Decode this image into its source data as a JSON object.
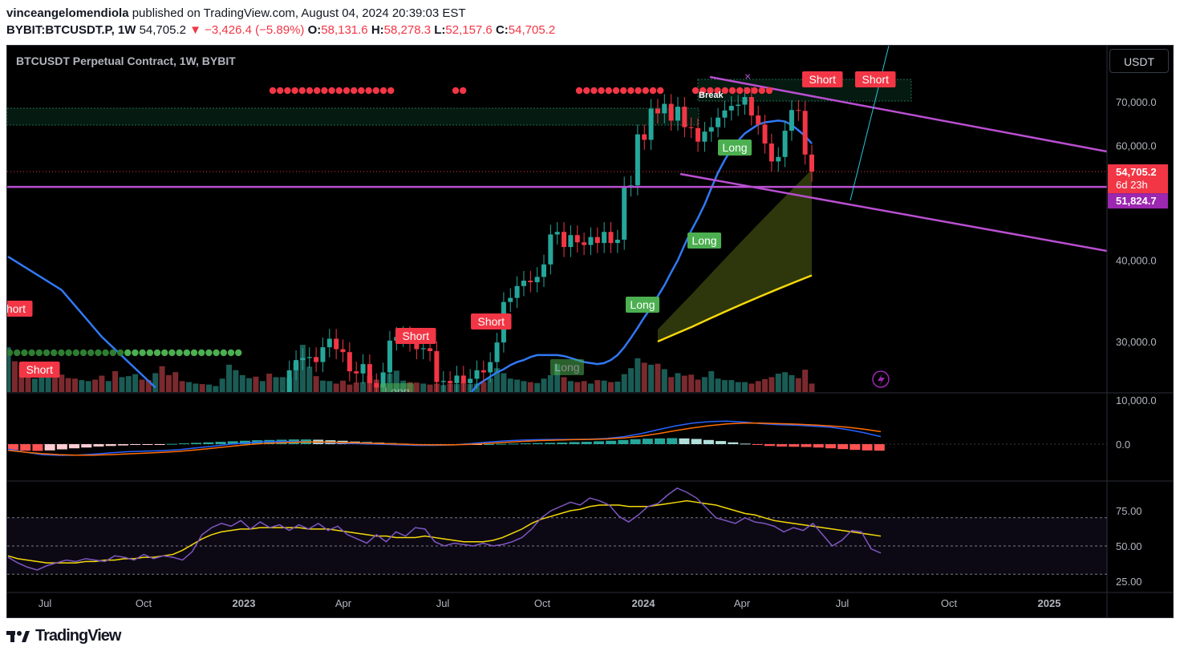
{
  "publisher": {
    "user": "vinceangelomendiola",
    "text": "published on TradingView.com, August 04, 2024 20:39:03 EST"
  },
  "symbol_line": {
    "symbol": "BYBIT:BTCUSDT.P, 1W",
    "last": "54,705.2",
    "change": "▼ −3,426.4 (−5.89%)",
    "o_label": "O:",
    "o": "58,131.6",
    "h_label": "H:",
    "h": "58,278.3",
    "l_label": "L:",
    "l": "52,157.6",
    "c_label": "C:",
    "c": "54,705.2"
  },
  "chart_title": "BTCUSDT Perpetual Contract, 1W, BYBIT",
  "currency_button": "USDT",
  "footer_logo": "TradingView",
  "colors": {
    "up": "#26a69a",
    "down": "#f23645",
    "channel": "#b94fd1",
    "ema": "#3179f5",
    "sma": "#f5d90a",
    "label_long": "#4caf50",
    "label_short": "#f23645"
  },
  "chart_data": [
    {
      "type": "line",
      "title": "BTCUSDT Perpetual Contract, 1W, BYBIT",
      "price_ticks": [
        "70,000.0",
        "60,000.0",
        "40,000.0",
        "30,000.0"
      ],
      "price_tick_values": [
        70000,
        60000,
        40000,
        30000
      ],
      "x_ticks": [
        "Jul",
        "Oct",
        "2023",
        "Apr",
        "Jul",
        "Oct",
        "2024",
        "Apr",
        "Jul",
        "Oct",
        "2025"
      ],
      "last_price_label": "54,705.2",
      "countdown_label": "6d 23h",
      "level_label": "51,824.7",
      "level_value": 51824.7,
      "signal_labels": [
        {
          "text": "Short",
          "kind": "short",
          "week": 4
        },
        {
          "text": "Short",
          "kind": "short",
          "week": 5
        },
        {
          "text": "Short",
          "kind": "short",
          "week": 51
        },
        {
          "text": "Long",
          "kind": "long",
          "week": 51
        },
        {
          "text": "Short",
          "kind": "short",
          "week": 60
        },
        {
          "text": "Long",
          "kind": "long",
          "week": 72
        },
        {
          "text": "Long",
          "kind": "long",
          "week": 83
        },
        {
          "text": "Long",
          "kind": "long",
          "week": 90
        },
        {
          "text": "Long",
          "kind": "long",
          "week": 95
        },
        {
          "text": "Short",
          "kind": "short",
          "week": 105
        },
        {
          "text": "Short",
          "kind": "short",
          "week": 110
        }
      ],
      "annotation": "Break",
      "closes": [
        22000,
        21500,
        20800,
        20500,
        21200,
        21900,
        23600,
        23300,
        21300,
        20000,
        19900,
        20200,
        21500,
        19300,
        18800,
        19500,
        19100,
        19400,
        20600,
        20900,
        19600,
        19100,
        21200,
        20800,
        17200,
        16600,
        16200,
        16800,
        17000,
        16400,
        16500,
        16600,
        17000,
        20900,
        22900,
        23100,
        23500,
        22600,
        24200,
        21600,
        23100,
        24300,
        27100,
        28100,
        28300,
        28400,
        27900,
        29400,
        30300,
        29200,
        28900,
        27000,
        26800,
        27700,
        25900,
        25500,
        26900,
        30100,
        30500,
        30600,
        30000,
        29200,
        29300,
        29000,
        26000,
        26100,
        25900,
        26600,
        25900,
        26300,
        27100,
        26900,
        27900,
        29900,
        34500,
        35000,
        36500,
        37200,
        37000,
        37700,
        39400,
        43800,
        44200,
        41900,
        43700,
        42600,
        42200,
        43400,
        42500,
        44200,
        42500,
        43000,
        51900,
        52100,
        62400,
        61200,
        68300,
        67200,
        69500,
        65500,
        68800,
        64000,
        63800,
        60800,
        63000,
        64000,
        66200,
        67900,
        69000,
        69300,
        71200,
        66700,
        64600,
        60400,
        56700,
        57600,
        63200,
        68000,
        67800,
        58100,
        54700
      ],
      "ema20": [
        22800,
        22200,
        21300,
        20600,
        19600,
        18800,
        18200,
        17500,
        16800,
        16300,
        16100,
        16200,
        16600,
        17300,
        18300,
        19300,
        20400,
        21500,
        22500,
        23300,
        24000,
        24900,
        25700,
        26100,
        26500,
        26900,
        27200,
        27600,
        27900,
        28100,
        28400,
        28600,
        28600,
        28600,
        28600,
        28500,
        28300,
        28100,
        27900,
        27800,
        27700,
        27800,
        28100,
        28600,
        29400,
        30400,
        31500,
        32700,
        33800,
        35200,
        36600,
        38300,
        40000,
        42200,
        44400,
        46400,
        48700,
        51600,
        54500,
        57000,
        59200,
        61000,
        62600,
        63600,
        64600,
        65100,
        65300,
        65500,
        65300,
        64500,
        63300,
        62000,
        60400
      ],
      "sma200": [
        30000,
        30800,
        31600,
        32500,
        33400,
        34300,
        35200,
        36100,
        37000,
        37900
      ],
      "volume": [
        0.9,
        0.62,
        0.55,
        0.35,
        0.27,
        0.32,
        0.4,
        0.3,
        0.35,
        0.28,
        0.27,
        0.24,
        0.22,
        0.25,
        0.33,
        0.22,
        0.42,
        0.3,
        0.32,
        0.36,
        0.25,
        0.24,
        0.38,
        0.52,
        0.34,
        0.4,
        0.22,
        0.2,
        0.17,
        0.16,
        0.15,
        0.12,
        0.27,
        0.55,
        0.44,
        0.34,
        0.28,
        0.31,
        0.22,
        0.37,
        0.3,
        0.3,
        0.28,
        0.6,
        0.95,
        0.51,
        0.32,
        0.23,
        0.22,
        0.17,
        0.23,
        0.15,
        0.19,
        0.2,
        0.32,
        0.25,
        0.16,
        0.37,
        0.43,
        0.23,
        0.2,
        0.19,
        0.17,
        0.15,
        0.17,
        0.14,
        0.17,
        0.16,
        0.2,
        0.16,
        0.17,
        0.2,
        0.28,
        0.48,
        0.38,
        0.27,
        0.25,
        0.22,
        0.2,
        0.18,
        0.27,
        0.34,
        0.56,
        0.3,
        0.22,
        0.2,
        0.22,
        0.17,
        0.24,
        0.23,
        0.2,
        0.21,
        0.36,
        0.48,
        0.68,
        0.59,
        0.55,
        0.57,
        0.46,
        0.3,
        0.38,
        0.33,
        0.35,
        0.25,
        0.3,
        0.42,
        0.27,
        0.24,
        0.24,
        0.2,
        0.2,
        0.17,
        0.22,
        0.26,
        0.3,
        0.37,
        0.4,
        0.34,
        0.28,
        0.45,
        0.17
      ]
    },
    {
      "type": "bar",
      "title": "",
      "y_ticks": [
        "10,000.0",
        "0.0"
      ],
      "y_tick_values": [
        10000,
        0
      ],
      "histogram": [
        -2200,
        -2500,
        -2600,
        -2400,
        -2000,
        -1600,
        -1300,
        -900,
        -700,
        -500,
        -300,
        -200,
        -100,
        100,
        300,
        500,
        700,
        900,
        1100,
        1300,
        1500,
        1600,
        1700,
        1800,
        1800,
        1700,
        1500,
        1300,
        1000,
        800,
        600,
        400,
        200,
        0,
        -200,
        -300,
        -300,
        -200,
        -100,
        0,
        100,
        200,
        300,
        400,
        500,
        600,
        800,
        900,
        1100,
        1300,
        1600,
        1900,
        2100,
        2200,
        2300,
        2200,
        2000,
        1600,
        1200,
        700,
        200,
        -300,
        -700,
        -900,
        -1000,
        -1100,
        -1300,
        -1600,
        -1900,
        -2200,
        -2400,
        -2500
      ],
      "macd": [
        -2000,
        -3200,
        -4200,
        -4500,
        -4400,
        -4000,
        -3500,
        -3000,
        -2800,
        -2600,
        -2200,
        -1500,
        -800,
        0,
        500,
        1000,
        1100,
        1000,
        800,
        600,
        300,
        100,
        -100,
        -300,
        -500,
        -500,
        -300,
        200,
        800,
        1300,
        1600,
        1800,
        1900,
        1900,
        2000,
        2300,
        3000,
        4200,
        5800,
        7300,
        8400,
        9000,
        9200,
        8800,
        8200,
        7800,
        7600,
        7200,
        6800,
        5900,
        4600,
        3000
      ],
      "signal": [
        -2500,
        -3200,
        -3800,
        -4200,
        -4400,
        -4400,
        -4200,
        -3900,
        -3600,
        -3300,
        -2900,
        -2300,
        -1600,
        -900,
        -200,
        300,
        600,
        800,
        900,
        800,
        600,
        400,
        200,
        0,
        -200,
        -300,
        -300,
        -100,
        300,
        700,
        1100,
        1400,
        1600,
        1800,
        1900,
        2100,
        2500,
        3200,
        4200,
        5400,
        6500,
        7400,
        8100,
        8400,
        8400,
        8200,
        8000,
        7700,
        7300,
        6800,
        6000,
        5000
      ]
    },
    {
      "type": "line",
      "title": "",
      "y_ticks": [
        "75.00",
        "50.00",
        "25.00"
      ],
      "y_tick_values": [
        75,
        50,
        25
      ],
      "rsi": [
        42,
        38,
        35,
        33,
        36,
        38,
        40,
        39,
        41,
        40,
        39,
        43,
        42,
        40,
        44,
        41,
        43,
        42,
        40,
        46,
        58,
        63,
        66,
        64,
        68,
        62,
        67,
        63,
        65,
        61,
        65,
        62,
        66,
        61,
        64,
        58,
        55,
        52,
        58,
        53,
        60,
        57,
        63,
        62,
        53,
        50,
        52,
        51,
        50,
        52,
        50,
        51,
        53,
        56,
        62,
        70,
        75,
        78,
        81,
        79,
        84,
        82,
        79,
        71,
        67,
        72,
        78,
        80,
        86,
        91,
        88,
        84,
        77,
        70,
        68,
        66,
        70,
        67,
        66,
        64,
        60,
        63,
        61,
        66,
        58,
        50,
        54,
        61,
        60,
        48,
        45
      ],
      "rsi_ma": [
        43,
        41,
        40,
        39,
        38,
        38,
        38,
        38,
        39,
        39,
        40,
        40,
        41,
        41,
        42,
        42,
        43,
        44,
        47,
        51,
        55,
        58,
        60,
        61,
        62,
        62,
        63,
        63,
        63,
        63,
        63,
        62,
        62,
        62,
        61,
        60,
        59,
        58,
        57,
        57,
        56,
        56,
        56,
        57,
        56,
        55,
        54,
        53,
        53,
        53,
        54,
        56,
        59,
        62,
        66,
        69,
        71,
        73,
        75,
        76,
        78,
        79,
        79,
        79,
        78,
        78,
        78,
        79,
        80,
        81,
        82,
        81,
        80,
        79,
        77,
        75,
        73,
        72,
        70,
        68,
        67,
        66,
        65,
        64,
        63,
        62,
        61,
        60,
        59,
        58,
        57
      ]
    }
  ]
}
